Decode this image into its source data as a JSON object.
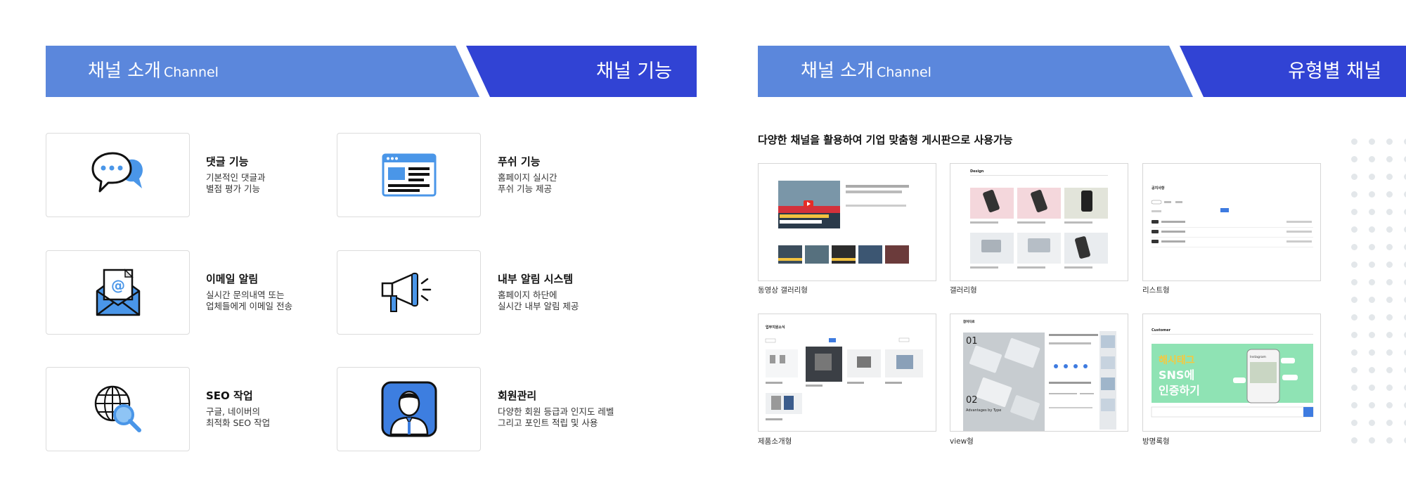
{
  "left_panel": {
    "header": {
      "title": "채널 소개",
      "title_en": "Channel",
      "right_title": "채널 기능"
    },
    "features": [
      {
        "title": "댓글 기능",
        "desc1": "기본적인 댓글과",
        "desc2": "별점 평가 기능",
        "icon": "speech-bubbles-icon"
      },
      {
        "title": "푸쉬 기능",
        "desc1": "홈페이지 실시간",
        "desc2": "푸쉬 기능 제공",
        "icon": "browser-window-icon"
      },
      {
        "title": "이메일 알림",
        "desc1": "실시간 문의내역 또는",
        "desc2": "업체들에게 이메일 전송",
        "icon": "email-envelope-icon"
      },
      {
        "title": "내부 알림 시스템",
        "desc1": "홈페이지 하단에",
        "desc2": "실시간 내부 알림 제공",
        "icon": "megaphone-icon"
      },
      {
        "title": "SEO 작업",
        "desc1": "구글, 네이버의",
        "desc2": "최적화 SEO 작업",
        "icon": "globe-search-icon"
      },
      {
        "title": "회원관리",
        "desc1": "다양한 회원 등급과 인지도 레벨",
        "desc2": "그리고 포인트 적립 및 사용",
        "icon": "member-profile-icon"
      }
    ]
  },
  "right_panel": {
    "header": {
      "title": "채널 소개",
      "title_en": "Channel",
      "right_title": "유형별 채널"
    },
    "intro": "다양한 채널을 활용하여 기업 맞춤형 게시판으로 사용가능",
    "thumbnails": [
      {
        "label": "동영상 갤러리형"
      },
      {
        "label": "갤러리형",
        "inner_title": "Design"
      },
      {
        "label": "리스트형",
        "inner_title": "공지사항"
      },
      {
        "label": "제품소개형",
        "inner_title": "업무지원소식"
      },
      {
        "label": "view형",
        "inner_title": "참여자료",
        "inner_num1": "01",
        "inner_num2": "02",
        "inner_text": "Advantages by Type"
      },
      {
        "label": "방명록형",
        "inner_title": "Customer",
        "inner_banner1": "해시태그",
        "inner_banner2": "SNS에",
        "inner_banner3": "인증하기",
        "inner_app": "Instagram"
      }
    ]
  },
  "colors": {
    "header_light": "#5b87dc",
    "header_dark": "#3143d4",
    "icon_blue": "#4a96e8",
    "member_bg": "#3d7ee0",
    "banner_green": "#8fe3b4",
    "banner_yellow": "#f7c83d"
  }
}
